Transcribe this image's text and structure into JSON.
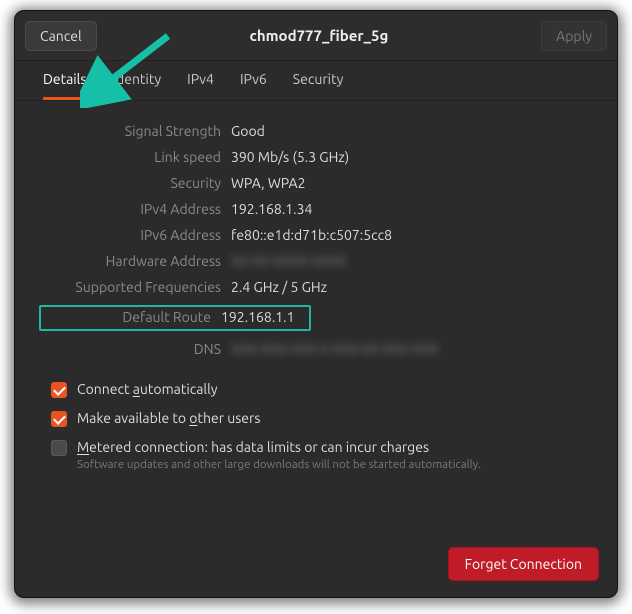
{
  "header": {
    "cancel": "Cancel",
    "title": "chmod777_fiber_5g",
    "apply": "Apply"
  },
  "tabs": [
    {
      "label": "Details",
      "active": true
    },
    {
      "label": "Identity",
      "active": false
    },
    {
      "label": "IPv4",
      "active": false
    },
    {
      "label": "IPv6",
      "active": false
    },
    {
      "label": "Security",
      "active": false
    }
  ],
  "details": {
    "signal_strength": {
      "label": "Signal Strength",
      "value": "Good"
    },
    "link_speed": {
      "label": "Link speed",
      "value": "390 Mb/s (5.3 GHz)"
    },
    "security": {
      "label": "Security",
      "value": "WPA, WPA2"
    },
    "ipv4": {
      "label": "IPv4 Address",
      "value": "192.168.1.34"
    },
    "ipv6": {
      "label": "IPv6 Address",
      "value": "fe80::e1d:d71b:c507:5cc8"
    },
    "hw": {
      "label": "Hardware Address",
      "value": "XX XX XXXX XXXX"
    },
    "freq": {
      "label": "Supported Frequencies",
      "value": "2.4 GHz / 5 GHz"
    },
    "route": {
      "label": "Default Route",
      "value": "192.168.1.1"
    },
    "dns": {
      "label": "DNS",
      "value": "XXX XXX XXX X XXX XX XXX XXX"
    }
  },
  "checks": {
    "auto_pre": "Connect ",
    "auto_u": "a",
    "auto_post": "utomatically",
    "share_pre": "Make available to ",
    "share_u": "o",
    "share_post": "ther users",
    "metered_u": "M",
    "metered_post": "etered connection: has data limits or can incur charges",
    "metered_sub": "Software updates and other large downloads will not be started automatically."
  },
  "footer": {
    "forget": "Forget Connection"
  }
}
